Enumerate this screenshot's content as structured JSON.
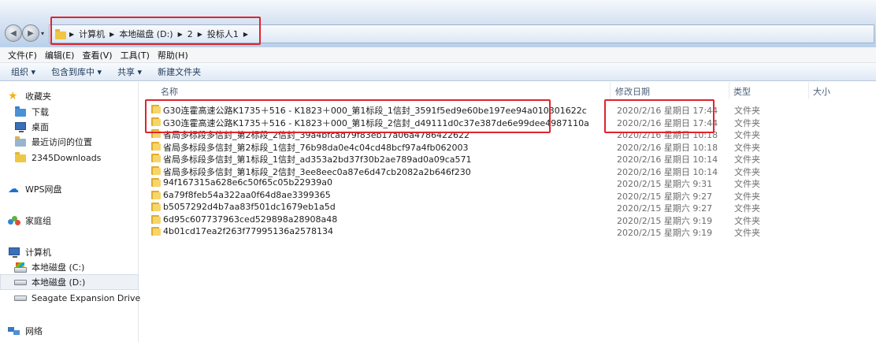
{
  "address": {
    "crumbs": [
      "计算机",
      "本地磁盘 (D:)",
      "2",
      "投标人1"
    ]
  },
  "menu": [
    "文件(F)",
    "编辑(E)",
    "查看(V)",
    "工具(T)",
    "帮助(H)"
  ],
  "commands": [
    "组织 ▾",
    "包含到库中 ▾",
    "共享 ▾",
    "新建文件夹"
  ],
  "nav": {
    "favorites": "收藏夹",
    "downloads": "下载",
    "desktop": "桌面",
    "recent": "最近访问的位置",
    "dl2345": "2345Downloads",
    "wps": "WPS网盘",
    "homegroup": "家庭组",
    "computer": "计算机",
    "drive_c": "本地磁盘 (C:)",
    "drive_d": "本地磁盘 (D:)",
    "seagate": "Seagate Expansion Drive",
    "network": "网络"
  },
  "columns": {
    "name": "名称",
    "date": "修改日期",
    "type": "类型",
    "size": "大小"
  },
  "files": [
    {
      "name": "G30连霍高速公路K1735＋516 - K1823＋000_第1标段_1信封_3591f5ed9e60be197ee94a010301622c",
      "date": "2020/2/16 星期日 17:44",
      "type": "文件夹"
    },
    {
      "name": "G30连霍高速公路K1735＋516 - K1823＋000_第1标段_2信封_d49111d0c37e387de6e99dee4987110a",
      "date": "2020/2/16 星期日 17:44",
      "type": "文件夹"
    },
    {
      "name": "省局多标段多信封_第2标段_2信封_39a4bfcad79f83eb17a06a4786422622",
      "date": "2020/2/16 星期日 10:18",
      "type": "文件夹"
    },
    {
      "name": "省局多标段多信封_第2标段_1信封_76b98da0e4c04cd48bcf97a4fb062003",
      "date": "2020/2/16 星期日 10:18",
      "type": "文件夹"
    },
    {
      "name": "省局多标段多信封_第1标段_1信封_ad353a2bd37f30b2ae789ad0a09ca571",
      "date": "2020/2/16 星期日 10:14",
      "type": "文件夹"
    },
    {
      "name": "省局多标段多信封_第1标段_2信封_3ee8eec0a87e6d47cb2082a2b646f230",
      "date": "2020/2/16 星期日 10:14",
      "type": "文件夹"
    },
    {
      "name": "94f167315a628e6c50f65c05b22939a0",
      "date": "2020/2/15 星期六 9:31",
      "type": "文件夹"
    },
    {
      "name": "6a79f8feb54a322aa0f64d8ae3399365",
      "date": "2020/2/15 星期六 9:27",
      "type": "文件夹"
    },
    {
      "name": "b5057292d4b7aa83f501dc1679eb1a5d",
      "date": "2020/2/15 星期六 9:27",
      "type": "文件夹"
    },
    {
      "name": "6d95c607737963ced529898a28908a48",
      "date": "2020/2/15 星期六 9:19",
      "type": "文件夹"
    },
    {
      "name": "4b01cd17ea2f263f77995136a2578134",
      "date": "2020/2/15 星期六 9:19",
      "type": "文件夹"
    }
  ],
  "colors": {
    "highlight_box": "#e0242e",
    "accent": "#1e395b"
  }
}
